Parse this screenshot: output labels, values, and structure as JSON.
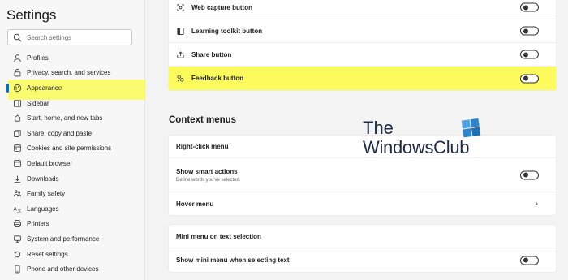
{
  "sidebar": {
    "title": "Settings",
    "search": {
      "placeholder": "Search settings"
    },
    "items": [
      {
        "label": "Profiles",
        "icon": "profile-icon"
      },
      {
        "label": "Privacy, search, and services",
        "icon": "lock-icon"
      },
      {
        "label": "Appearance",
        "icon": "appearance-icon",
        "active": true
      },
      {
        "label": "Sidebar",
        "icon": "sidebar-icon"
      },
      {
        "label": "Start, home, and new tabs",
        "icon": "home-icon"
      },
      {
        "label": "Share, copy and paste",
        "icon": "share-icon"
      },
      {
        "label": "Cookies and site permissions",
        "icon": "cookies-icon"
      },
      {
        "label": "Default browser",
        "icon": "browser-icon"
      },
      {
        "label": "Downloads",
        "icon": "download-icon"
      },
      {
        "label": "Family safety",
        "icon": "family-icon"
      },
      {
        "label": "Languages",
        "icon": "language-icon"
      },
      {
        "label": "Printers",
        "icon": "printer-icon"
      },
      {
        "label": "System and performance",
        "icon": "system-icon"
      },
      {
        "label": "Reset settings",
        "icon": "reset-icon"
      },
      {
        "label": "Phone and other devices",
        "icon": "phone-icon"
      }
    ]
  },
  "toolbar_buttons": [
    {
      "label": "Web capture button",
      "icon": "web-capture-icon",
      "toggle": false
    },
    {
      "label": "Learning toolkit button",
      "icon": "learning-toolkit-icon",
      "toggle": false
    },
    {
      "label": "Share button",
      "icon": "share-icon",
      "toggle": false
    },
    {
      "label": "Feedback button",
      "icon": "feedback-icon",
      "toggle": false
    }
  ],
  "context_menus": {
    "title": "Context menus",
    "right_click_menu": "Right-click menu",
    "show_smart_actions": "Show smart actions",
    "show_smart_actions_desc": "Define words you've selected.",
    "hover_menu": "Hover menu",
    "mini_menu_title": "Mini menu on text selection",
    "show_mini_menu": "Show mini menu when selecting text"
  },
  "watermark": {
    "line1": "The",
    "line2": "WindowsClub"
  },
  "colors": {
    "highlight": "#fbfb5c",
    "accent": "#0f6cbd"
  }
}
